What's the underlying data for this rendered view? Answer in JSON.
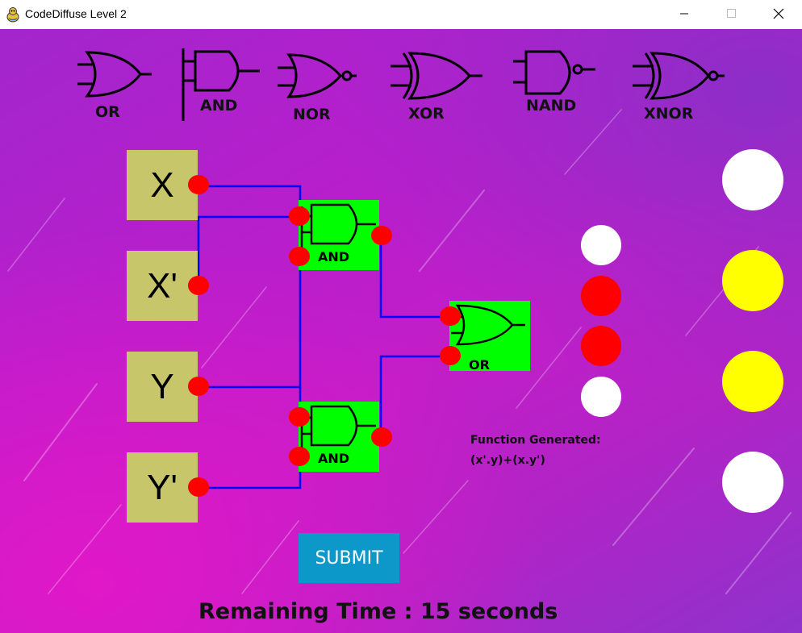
{
  "window": {
    "title": "CodeDiffuse Level 2",
    "app_icon": "pygame-snake-icon",
    "controls": [
      "minimize-icon",
      "maximize-icon",
      "close-icon"
    ]
  },
  "toolbar": {
    "gates": [
      {
        "type": "OR",
        "label": "OR"
      },
      {
        "type": "AND",
        "label": "AND"
      },
      {
        "type": "NOR",
        "label": "NOR"
      },
      {
        "type": "XOR",
        "label": "XOR"
      },
      {
        "type": "NAND",
        "label": "NAND"
      },
      {
        "type": "XNOR",
        "label": "XNOR"
      }
    ]
  },
  "inputs": [
    {
      "label": "X"
    },
    {
      "label": "X'"
    },
    {
      "label": "Y"
    },
    {
      "label": "Y'"
    }
  ],
  "placed_gates": [
    {
      "type": "AND",
      "label": "AND"
    },
    {
      "type": "AND",
      "label": "AND"
    },
    {
      "type": "OR",
      "label": "OR"
    }
  ],
  "output_states": [
    "white",
    "red",
    "red",
    "white"
  ],
  "expected_states": [
    "white",
    "yellow",
    "yellow",
    "white"
  ],
  "function": {
    "heading": "Function Generated:",
    "expression": "(x'.y)+(x.y')"
  },
  "submit_label": "SUBMIT",
  "timer_text": "Remaining Time : 15 seconds",
  "colors": {
    "background": "#b81ecc",
    "input_block": "#c8c66a",
    "gate_fill": "#00ff00",
    "port": "#ff0000",
    "wire": "#0000ff",
    "submit": "#0c98c8",
    "lamp_on": "#ffff00",
    "lamp_off": "#ffffff",
    "lamp_wrong": "#ff0000"
  }
}
